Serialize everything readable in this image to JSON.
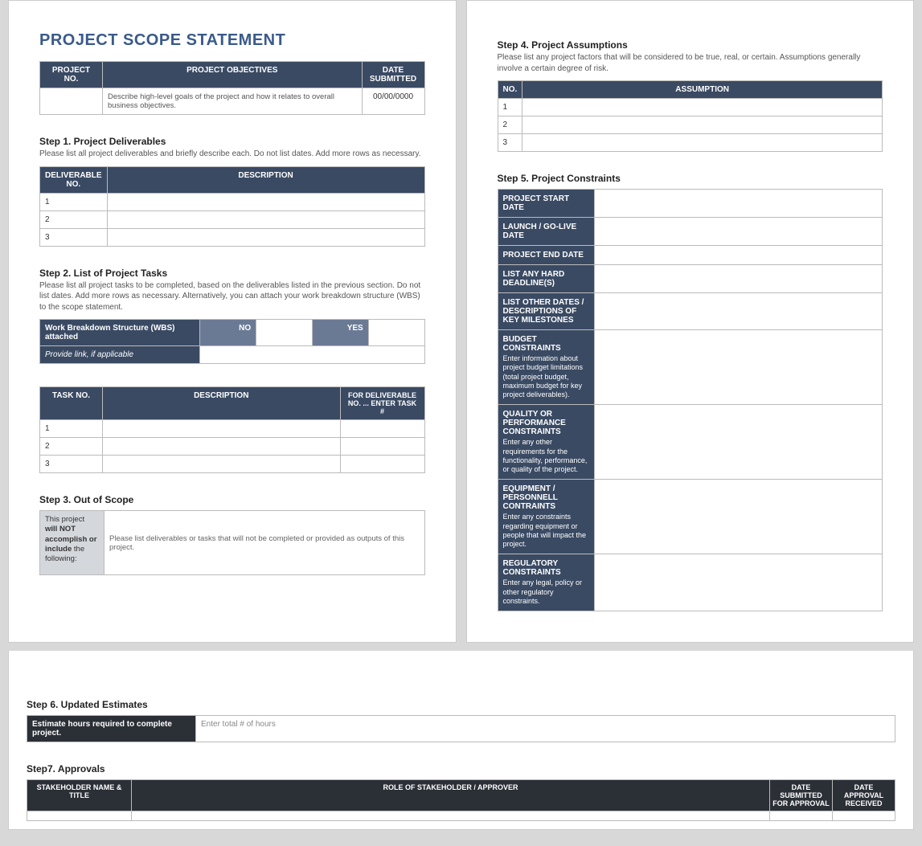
{
  "title": "PROJECT SCOPE STATEMENT",
  "header_table": {
    "cols": [
      "PROJECT NO.",
      "PROJECT OBJECTIVES",
      "DATE SUBMITTED"
    ],
    "row": {
      "project_no": "",
      "objectives": "Describe high-level goals of the project and how it relates to overall business objectives.",
      "date": "00/00/0000"
    }
  },
  "step1": {
    "heading": "Step 1. Project Deliverables",
    "desc": "Please list all project deliverables and briefly describe each. Do not list dates. Add more rows as necessary.",
    "cols": [
      "DELIVERABLE NO.",
      "DESCRIPTION"
    ],
    "rows": [
      {
        "no": "1",
        "desc": ""
      },
      {
        "no": "2",
        "desc": ""
      },
      {
        "no": "3",
        "desc": ""
      }
    ]
  },
  "step2": {
    "heading": "Step 2. List of Project Tasks",
    "desc": "Please list all project tasks to be completed, based on the deliverables listed in the previous section. Do not list dates. Add more rows as necessary. Alternatively, you can attach your work breakdown structure (WBS) to the scope statement.",
    "wbs": {
      "label": "Work Breakdown Structure (WBS) attached",
      "no": "NO",
      "yes": "YES",
      "link_label": "Provide link, if applicable"
    },
    "cols": [
      "TASK NO.",
      "DESCRIPTION",
      "FOR DELIVERABLE NO. ... ENTER TASK #"
    ],
    "rows": [
      {
        "no": "1",
        "desc": "",
        "for": ""
      },
      {
        "no": "2",
        "desc": "",
        "for": ""
      },
      {
        "no": "3",
        "desc": "",
        "for": ""
      }
    ]
  },
  "step3": {
    "heading": "Step 3. Out of Scope",
    "label_pre": "This project ",
    "label_bold": "will NOT accomplish or include",
    "label_post": " the following:",
    "desc": "Please list deliverables or tasks that will not be completed or provided as outputs of this project."
  },
  "step4": {
    "heading": "Step 4. Project Assumptions",
    "desc": "Please list any project factors that will be considered to be true, real, or certain. Assumptions generally involve a certain degree of risk.",
    "cols": [
      "NO.",
      "ASSUMPTION"
    ],
    "rows": [
      {
        "no": "1",
        "val": ""
      },
      {
        "no": "2",
        "val": ""
      },
      {
        "no": "3",
        "val": ""
      }
    ]
  },
  "step5": {
    "heading": "Step 5. Project Constraints",
    "rows": [
      {
        "label": "PROJECT START DATE",
        "sub": ""
      },
      {
        "label": "LAUNCH / GO-LIVE DATE",
        "sub": ""
      },
      {
        "label": "PROJECT END DATE",
        "sub": ""
      },
      {
        "label": "LIST ANY HARD DEADLINE(S)",
        "sub": ""
      },
      {
        "label": "LIST OTHER DATES / DESCRIPTIONS OF KEY MILESTONES",
        "sub": ""
      },
      {
        "label": "BUDGET CONSTRAINTS",
        "sub": "Enter information about project budget limitations (total project budget, maximum budget for key project deliverables)."
      },
      {
        "label": "QUALITY OR PERFORMANCE CONSTRAINTS",
        "sub": "Enter any other requirements for the functionality, performance, or quality of the project."
      },
      {
        "label": "EQUIPMENT / PERSONNELL CONTRAINTS",
        "sub": "Enter any constraints regarding equipment or people that will impact the project."
      },
      {
        "label": "REGULATORY CONSTRAINTS",
        "sub": "Enter any legal, policy or other regulatory constraints."
      }
    ]
  },
  "step6": {
    "heading": "Step 6. Updated Estimates",
    "label": "Estimate hours required to complete project.",
    "placeholder": "Enter total # of hours"
  },
  "step7": {
    "heading": "Step7. Approvals",
    "cols": [
      "STAKEHOLDER NAME & TITLE",
      "ROLE OF STAKEHOLDER / APPROVER",
      "DATE SUBMITTED FOR APPROVAL",
      "DATE APPROVAL RECEIVED"
    ]
  }
}
